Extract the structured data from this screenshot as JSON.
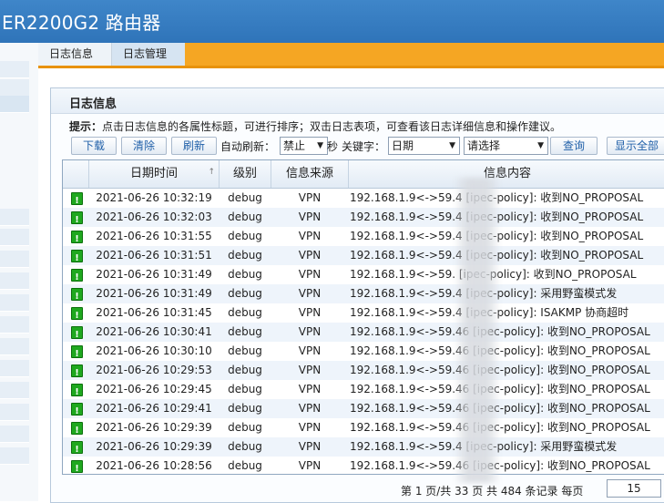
{
  "app": {
    "title": "ER2200G2 路由器"
  },
  "tabs": [
    {
      "label": "日志信息"
    },
    {
      "label": "日志管理"
    }
  ],
  "panel": {
    "title": "日志信息",
    "tip_label": "提示：",
    "tip_text": "点击日志信息的各属性标题，可进行排序；双击日志表项，可查看该日志详细信息和操作建议。"
  },
  "toolbar": {
    "download": "下载",
    "clear": "清除",
    "refresh": "刷新",
    "auto_refresh_label": "自动刷新：",
    "auto_refresh_value": "禁止",
    "seconds_label": "秒",
    "keyword_label": "关键字：",
    "keyword_field": "日期",
    "keyword_select": "请选择",
    "query": "查询",
    "show_all": "显示全部"
  },
  "table": {
    "columns": [
      "日期时间",
      "级别",
      "信息来源",
      "信息内容"
    ],
    "rows": [
      {
        "time": "2021-06-26 10:32:19",
        "level": "debug",
        "source": "VPN",
        "message": "192.168.1.9<->59.4     [ipec-policy]: 收到NO_PROPOSAL"
      },
      {
        "time": "2021-06-26 10:32:03",
        "level": "debug",
        "source": "VPN",
        "message": "192.168.1.9<->59.4     [ipec-policy]: 收到NO_PROPOSAL"
      },
      {
        "time": "2021-06-26 10:31:55",
        "level": "debug",
        "source": "VPN",
        "message": "192.168.1.9<->59.4     [ipec-policy]: 收到NO_PROPOSAL"
      },
      {
        "time": "2021-06-26 10:31:51",
        "level": "debug",
        "source": "VPN",
        "message": "192.168.1.9<->59.4     [ipec-policy]: 收到NO_PROPOSAL"
      },
      {
        "time": "2021-06-26 10:31:49",
        "level": "debug",
        "source": "VPN",
        "message": "192.168.1.9<->59.      [ipec-policy]: 收到NO_PROPOSAL"
      },
      {
        "time": "2021-06-26 10:31:49",
        "level": "debug",
        "source": "VPN",
        "message": "192.168.1.9<->59.4     [ipec-policy]: 采用野蛮模式发"
      },
      {
        "time": "2021-06-26 10:31:45",
        "level": "debug",
        "source": "VPN",
        "message": "192.168.1.9<->59.4     [ipec-policy]: ISAKMP 协商超时"
      },
      {
        "time": "2021-06-26 10:30:41",
        "level": "debug",
        "source": "VPN",
        "message": "192.168.1.9<->59.46    [ipec-policy]: 收到NO_PROPOSAL"
      },
      {
        "time": "2021-06-26 10:30:10",
        "level": "debug",
        "source": "VPN",
        "message": "192.168.1.9<->59.46    [ipec-policy]: 收到NO_PROPOSAL"
      },
      {
        "time": "2021-06-26 10:29:53",
        "level": "debug",
        "source": "VPN",
        "message": "192.168.1.9<->59.46    [ipec-policy]: 收到NO_PROPOSAL"
      },
      {
        "time": "2021-06-26 10:29:45",
        "level": "debug",
        "source": "VPN",
        "message": "192.168.1.9<->59.46    [ipec-policy]: 收到NO_PROPOSAL"
      },
      {
        "time": "2021-06-26 10:29:41",
        "level": "debug",
        "source": "VPN",
        "message": "192.168.1.9<->59.46    [ipec-policy]: 收到NO_PROPOSAL"
      },
      {
        "time": "2021-06-26 10:29:39",
        "level": "debug",
        "source": "VPN",
        "message": "192.168.1.9<->59.46    [ipec-policy]: 收到NO_PROPOSAL"
      },
      {
        "time": "2021-06-26 10:29:39",
        "level": "debug",
        "source": "VPN",
        "message": "192.168.1.9<->59.4     [ipec-policy]: 采用野蛮模式发"
      },
      {
        "time": "2021-06-26 10:28:56",
        "level": "debug",
        "source": "VPN",
        "message": "192.168.1.9<->59.46    [ipec-policy]: 收到NO_PROPOSAL"
      }
    ]
  },
  "pager": {
    "summary": "第 1 页/共 33 页 共 484 条记录 每页",
    "per_page": "15"
  },
  "colors": {
    "header_blue": "#2f74b9",
    "tab_orange": "#f5a623",
    "ok_green": "#1fa81f"
  }
}
